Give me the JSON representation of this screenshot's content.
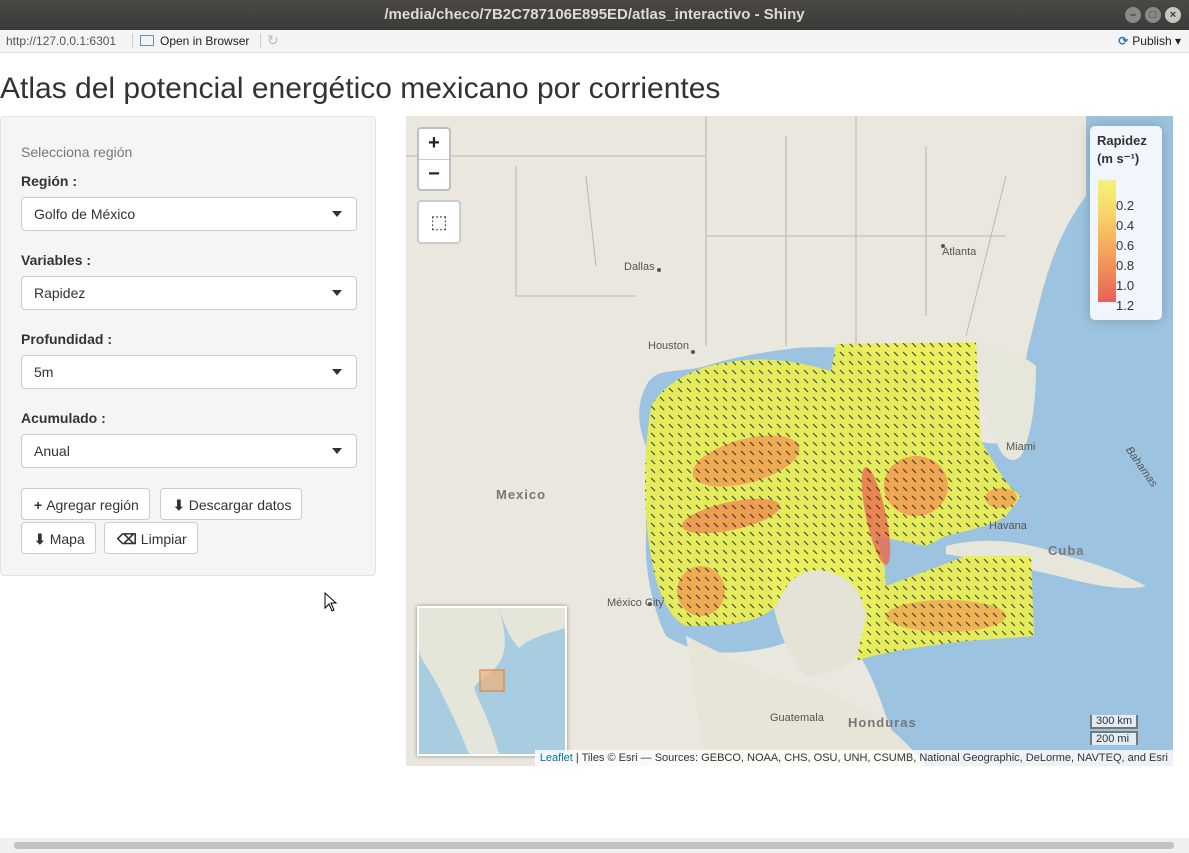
{
  "window": {
    "title": "/media/checo/7B2C787106E895ED/atlas_interactivo - Shiny",
    "min": "–",
    "max": "□",
    "close": "×"
  },
  "toolbar": {
    "url": "http://127.0.0.1:6301",
    "open_label": "Open in Browser",
    "refresh_icon": "↻",
    "publish_label": "Publish",
    "publish_icon": "⟳",
    "publish_caret": "▾"
  },
  "page": {
    "title": "Atlas del potencial energético mexicano por corrientes"
  },
  "sidebar": {
    "subtitle": "Selecciona región",
    "fields": [
      {
        "label": "Región :",
        "value": "Golfo de México"
      },
      {
        "label": "Variables :",
        "value": "Rapidez"
      },
      {
        "label": "Profundidad :",
        "value": "5m"
      },
      {
        "label": "Acumulado :",
        "value": "Anual"
      }
    ],
    "buttons": {
      "add": "Agregar región",
      "download": "Descargar datos",
      "map": "Mapa",
      "clear": "Limpiar"
    },
    "icons": {
      "add": "+",
      "download": "⬇",
      "map": "⬇",
      "clear": "⌫"
    }
  },
  "map": {
    "zoom_in": "+",
    "zoom_out": "−",
    "draw_icon": "⬚",
    "legend": {
      "title_line1": "Rapidez",
      "title_line2": "(m s⁻¹)",
      "ticks": [
        "0.2",
        "0.4",
        "0.6",
        "0.8",
        "1.0",
        "1.2"
      ]
    },
    "labels": {
      "dallas": "Dallas",
      "houston": "Houston",
      "atlanta": "Atlanta",
      "miami": "Miami",
      "havana": "Havana",
      "cuba": "Cuba",
      "mexico": "Mexico",
      "mexico_city": "México City",
      "guatemala": "Guatemala",
      "honduras": "Honduras",
      "bahamas": "Bahamas"
    },
    "scale": {
      "km": "300 km",
      "mi": "200 mi"
    },
    "attribution": {
      "link": "Leaflet",
      "text": " | Tiles © Esri — Sources: GEBCO, NOAA, CHS, OSU, UNH, CSUMB, National Geographic, DeLorme, NAVTEQ, and Esri"
    }
  }
}
